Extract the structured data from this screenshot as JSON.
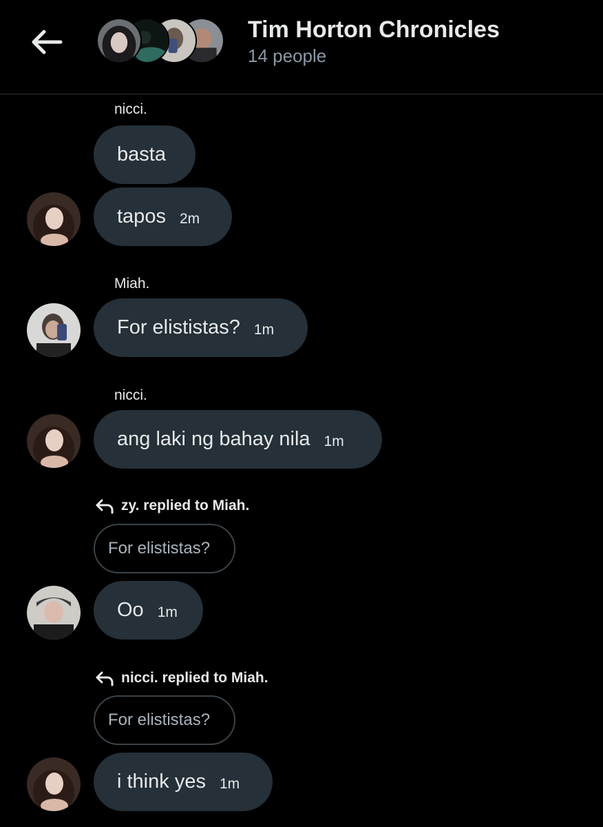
{
  "header": {
    "title": "Tim Horton Chronicles",
    "subtitle": "14 people",
    "icons": {
      "back": "arrow-left-icon"
    }
  },
  "colors": {
    "background": "#000000",
    "bubble": "#253038",
    "text": "#e7e9ea",
    "muted": "#8b98a5",
    "divider": "#2f3336"
  },
  "messages": [
    {
      "sender": "nicci.",
      "text": "basta",
      "time": ""
    },
    {
      "sender": "",
      "text": "tapos",
      "time": "2m"
    },
    {
      "sender": "Miah.",
      "text": "For elististas?",
      "time": "1m"
    },
    {
      "sender": "nicci.",
      "text": "ang laki ng bahay nila",
      "time": "1m"
    },
    {
      "reply_header": "zy. replied to Miah.",
      "quoted": "For elististas?",
      "text": "Oo",
      "time": "1m"
    },
    {
      "reply_header": "nicci. replied to Miah.",
      "quoted": "For elististas?",
      "text": "i think yes",
      "time": "1m"
    }
  ]
}
